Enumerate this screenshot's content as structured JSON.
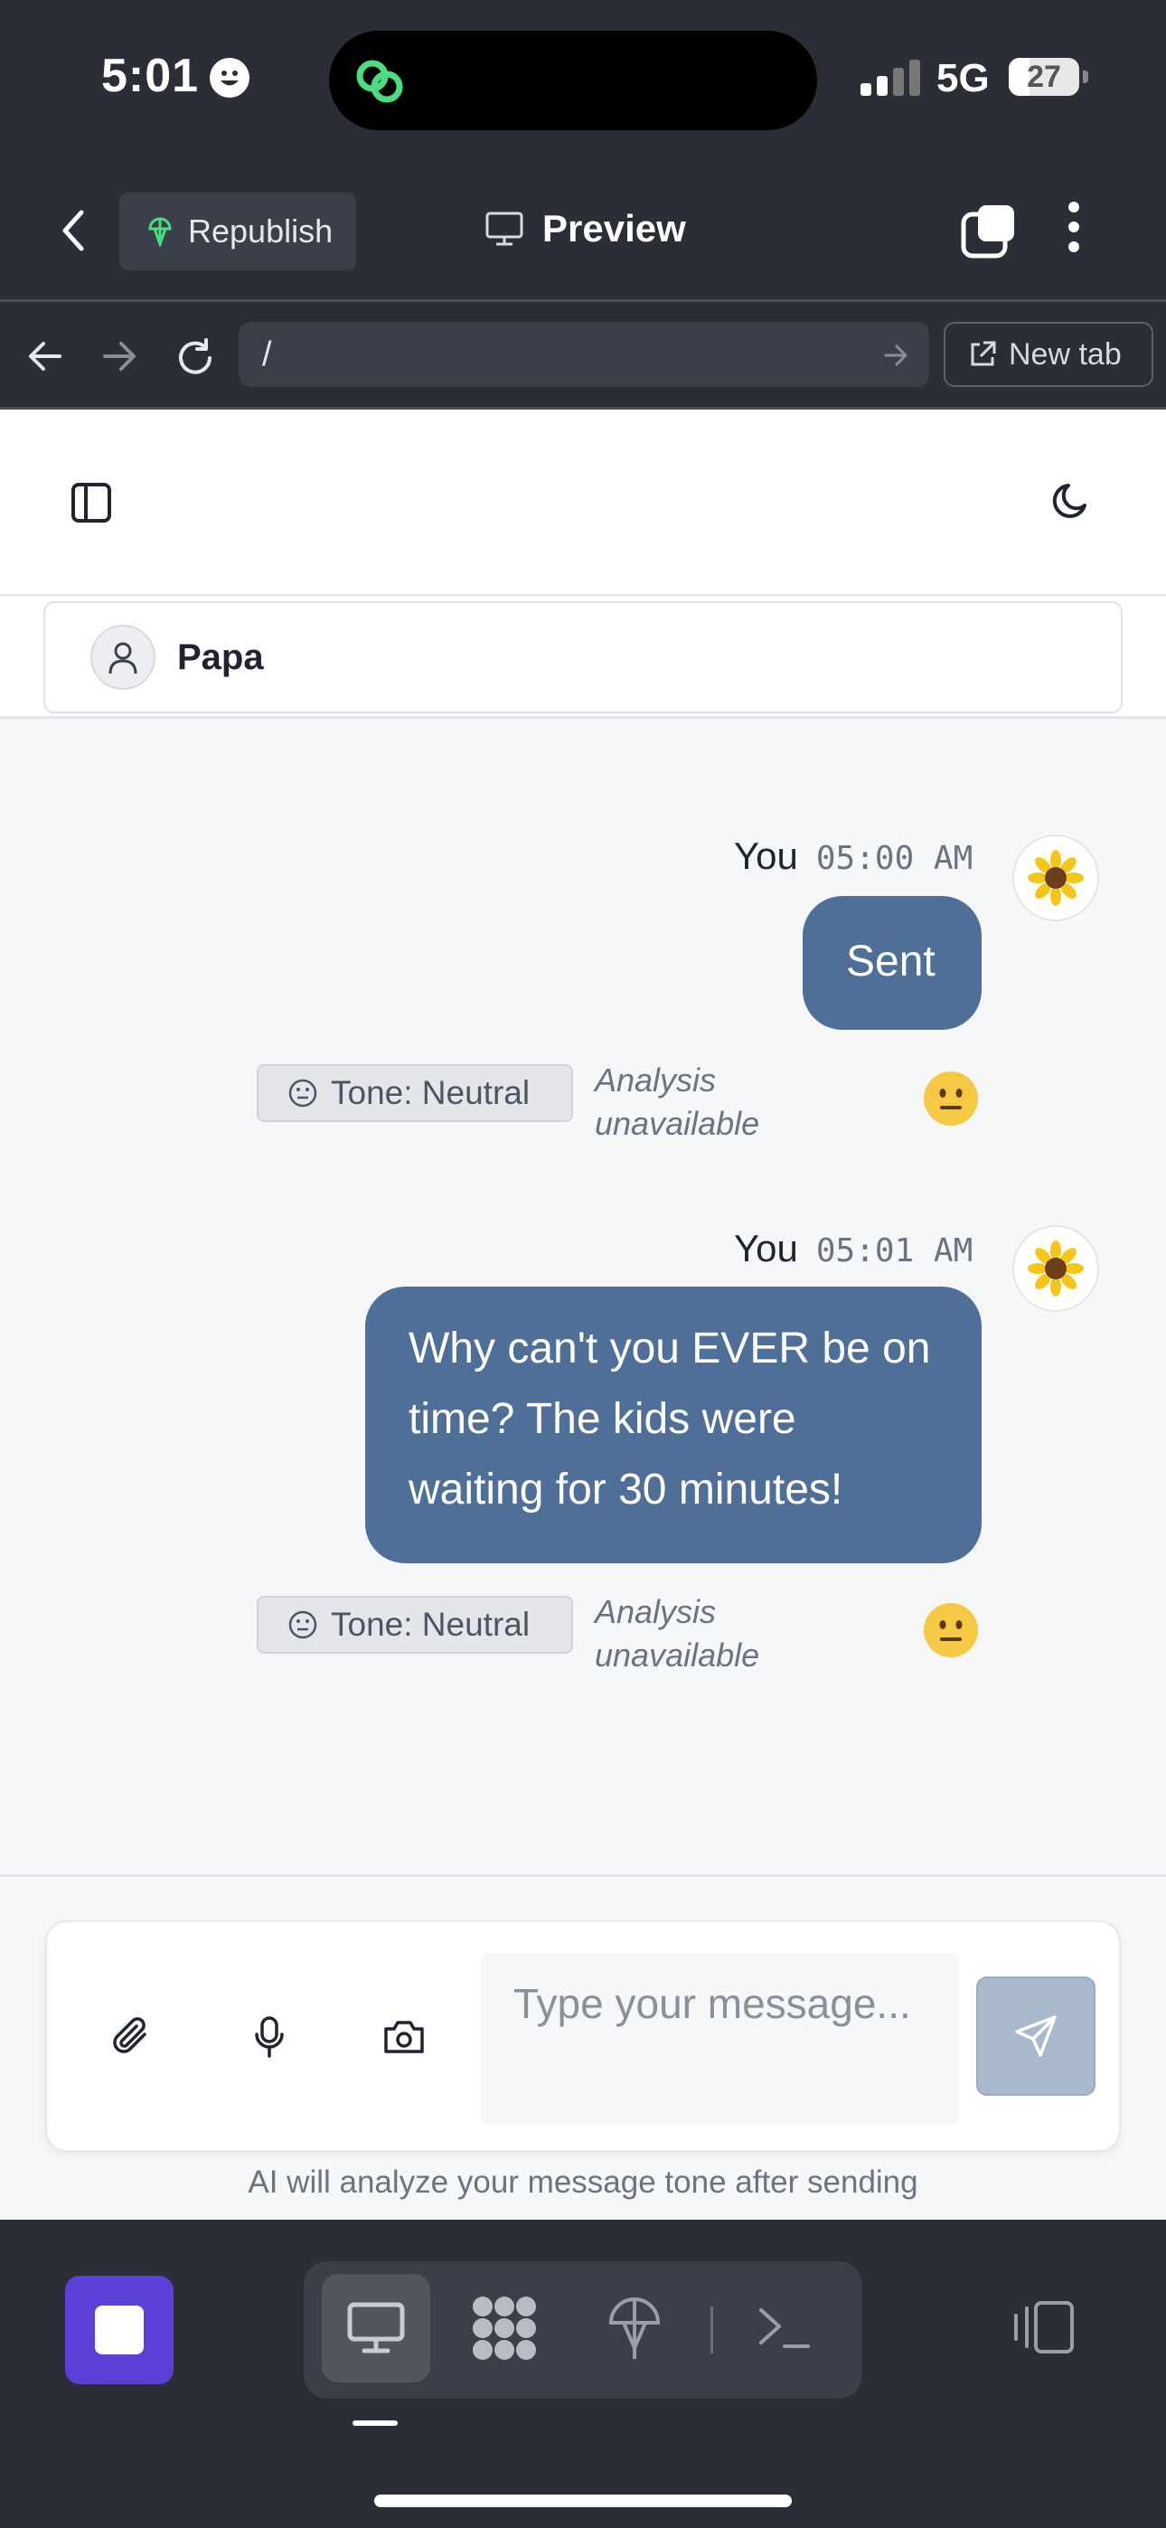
{
  "status_bar": {
    "time": "5:01",
    "network": "5G",
    "battery": "27"
  },
  "app_header": {
    "republish_label": "Republish",
    "title": "Preview"
  },
  "browser": {
    "url": "/",
    "new_tab_label": "New tab"
  },
  "chat": {
    "contact_name": "Papa",
    "messages": [
      {
        "sender": "You",
        "time": "05:00 AM",
        "text": "Sent",
        "tone": "Tone: Neutral",
        "analysis": "Analysis unavailable"
      },
      {
        "sender": "You",
        "time": "05:01 AM",
        "text": "Why can't you EVER be on time? The kids were waiting for 30 minutes!",
        "tone": "Tone: Neutral",
        "analysis": "Analysis unavailable"
      }
    ]
  },
  "composer": {
    "placeholder": "Type your message...",
    "hint": "AI will analyze your message tone after sending"
  },
  "colors": {
    "bubble": "#4f6f99",
    "dark_chrome": "#2b2e36",
    "stop_button": "#5b3fd6",
    "send_disabled": "#a9b9cd"
  },
  "icons": [
    "back-icon",
    "republish-icon",
    "monitor-icon",
    "tabs-icon",
    "kebab-icon",
    "arrow-left-icon",
    "arrow-right-icon",
    "reload-icon",
    "external-link-icon",
    "sidebar-icon",
    "moon-icon",
    "user-icon",
    "sunflower-icon",
    "neutral-face-icon",
    "paperclip-icon",
    "mic-icon",
    "camera-icon",
    "send-icon",
    "stop-icon",
    "desktop-icon",
    "grid-icon",
    "network-icon",
    "terminal-icon",
    "panels-icon"
  ]
}
